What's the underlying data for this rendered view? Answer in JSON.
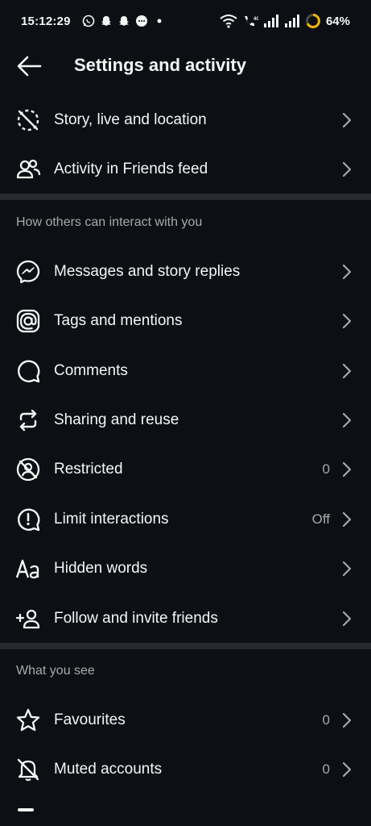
{
  "status_bar": {
    "time": "15:12:29",
    "battery": "64%",
    "icons": [
      "whatsapp-icon",
      "snapchat-icon",
      "snapchat-icon",
      "message-icon",
      "dot-icon",
      "wifi-icon",
      "volte-call-icon",
      "signal-icon",
      "signal-icon",
      "battery-icon"
    ]
  },
  "header": {
    "title": "Settings and activity"
  },
  "top_items": [
    {
      "label": "Story, live and location",
      "icon": "story-hidden-icon"
    },
    {
      "label": "Activity in Friends feed",
      "icon": "friends-icon"
    }
  ],
  "section_interact": {
    "title": "How others can interact with you",
    "items": [
      {
        "label": "Messages and story replies",
        "icon": "messenger-icon",
        "value": ""
      },
      {
        "label": "Tags and mentions",
        "icon": "at-icon",
        "value": ""
      },
      {
        "label": "Comments",
        "icon": "comment-icon",
        "value": ""
      },
      {
        "label": "Sharing and reuse",
        "icon": "repost-icon",
        "value": ""
      },
      {
        "label": "Restricted",
        "icon": "restricted-icon",
        "value": "0"
      },
      {
        "label": "Limit interactions",
        "icon": "limit-icon",
        "value": "Off"
      },
      {
        "label": "Hidden words",
        "icon": "text-aa-icon",
        "value": ""
      },
      {
        "label": "Follow and invite friends",
        "icon": "add-person-icon",
        "value": ""
      }
    ]
  },
  "section_see": {
    "title": "What you see",
    "items": [
      {
        "label": "Favourites",
        "icon": "star-icon",
        "value": "0"
      },
      {
        "label": "Muted accounts",
        "icon": "muted-bell-icon",
        "value": "0"
      }
    ]
  },
  "colors": {
    "background": "#0c1014",
    "text": "#f5f5f5",
    "secondary": "#a8a8a8",
    "divider": "#262a30"
  }
}
